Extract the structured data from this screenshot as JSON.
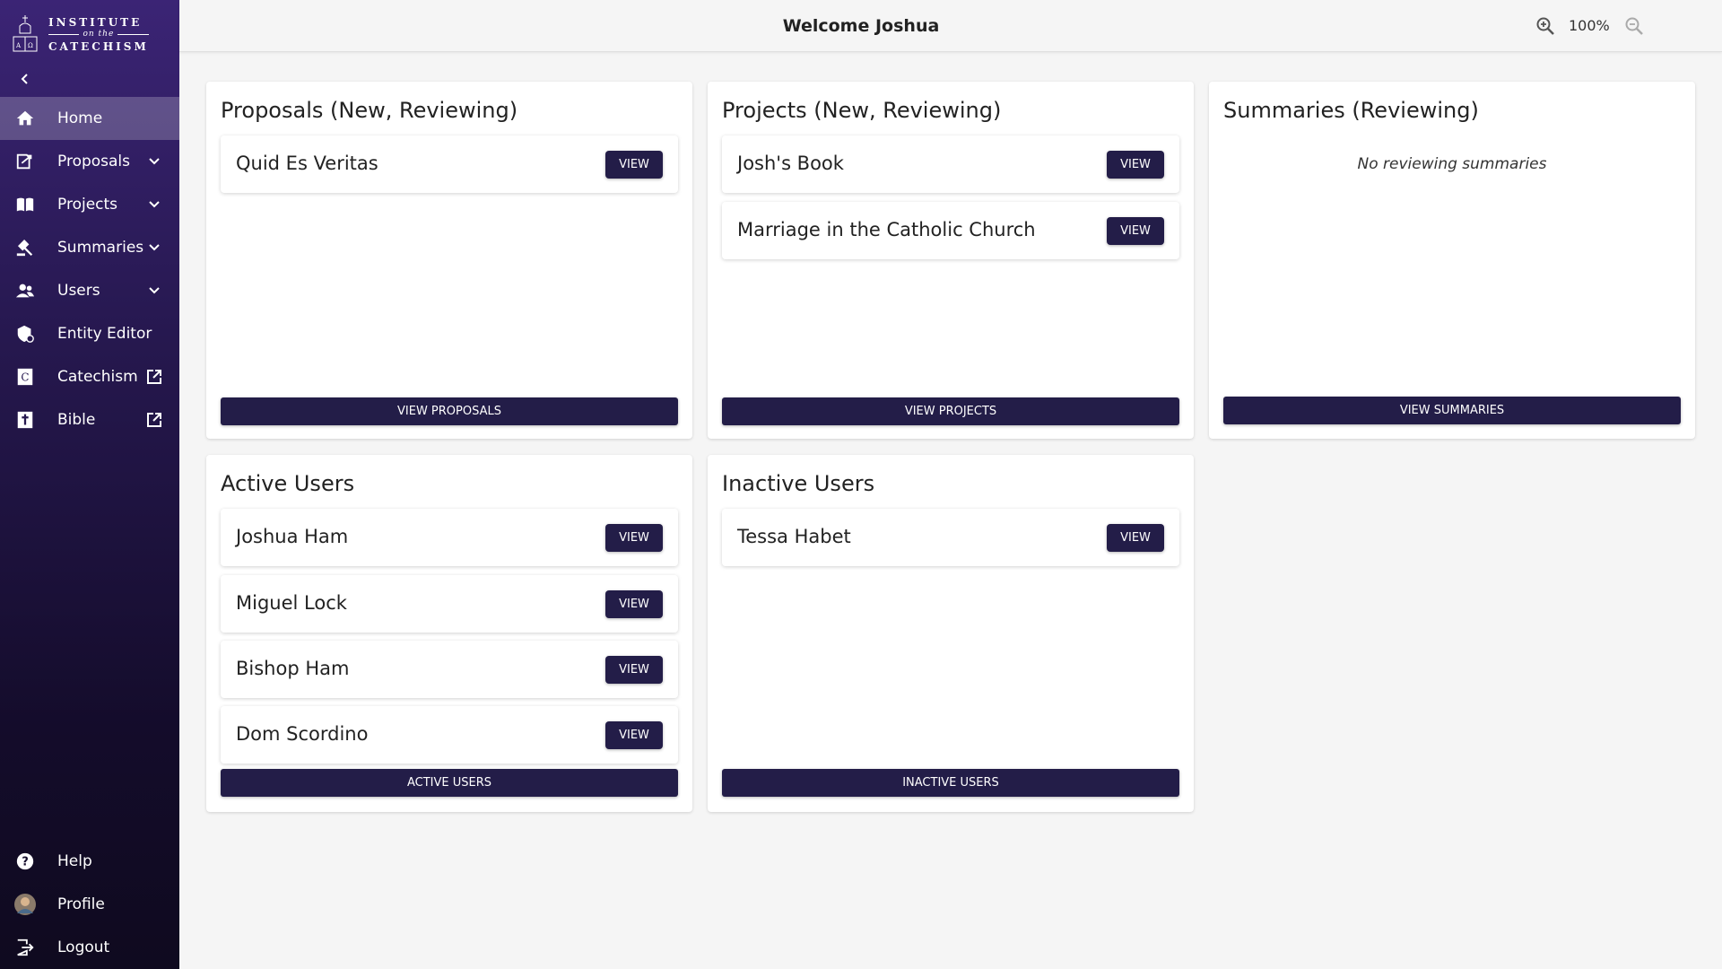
{
  "app": {
    "logo_line1": "INSTITUTE",
    "logo_line2": "on the",
    "logo_line3": "CATECHISM"
  },
  "header": {
    "title": "Welcome Joshua",
    "zoom": "100%"
  },
  "sidebar": {
    "items": [
      {
        "label": "Home",
        "icon": "home-icon"
      },
      {
        "label": "Proposals",
        "icon": "proposal-icon"
      },
      {
        "label": "Projects",
        "icon": "book-icon"
      },
      {
        "label": "Summaries",
        "icon": "gavel-icon"
      },
      {
        "label": "Users",
        "icon": "users-icon"
      },
      {
        "label": "Entity Editor",
        "icon": "entity-icon"
      },
      {
        "label": "Catechism",
        "icon": "catechism-icon"
      },
      {
        "label": "Bible",
        "icon": "bible-icon"
      }
    ],
    "bottom": [
      {
        "label": "Help",
        "icon": "help-icon"
      },
      {
        "label": "Profile",
        "icon": "avatar"
      },
      {
        "label": "Logout",
        "icon": "logout-icon"
      }
    ]
  },
  "cards": {
    "proposals": {
      "title": "Proposals (New, Reviewing)",
      "items": [
        "Quid Es Veritas"
      ],
      "button": "VIEW PROPOSALS"
    },
    "projects": {
      "title": "Projects (New, Reviewing)",
      "items": [
        "Josh's Book",
        "Marriage in the Catholic Church"
      ],
      "button": "VIEW PROJECTS"
    },
    "summaries": {
      "title": "Summaries (Reviewing)",
      "empty": "No reviewing summaries",
      "button": "VIEW SUMMARIES"
    },
    "active_users": {
      "title": "Active Users",
      "items": [
        "Joshua Ham",
        "Miguel Lock",
        "Bishop Ham",
        "Dom Scordino"
      ],
      "button": "ACTIVE USERS"
    },
    "inactive_users": {
      "title": "Inactive Users",
      "items": [
        "Tessa Habet"
      ],
      "button": "INACTIVE USERS"
    }
  },
  "view_label": "VIEW",
  "colors": {
    "button": "#231d48",
    "sidebar_top": "#3b2475",
    "sidebar_bottom": "#0f0a1f"
  }
}
